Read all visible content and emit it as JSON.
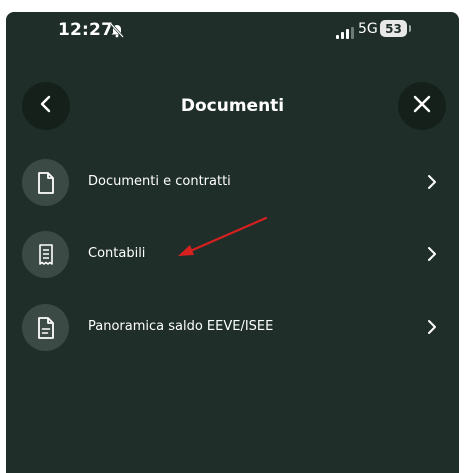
{
  "status_bar": {
    "time": "12:27",
    "network": "5G",
    "battery": "53",
    "icons": [
      "bell-slash-icon",
      "signal-icon",
      "battery-icon"
    ]
  },
  "header": {
    "title": "Documenti",
    "back_icon": "chevron-left-icon",
    "close_icon": "close-icon"
  },
  "menu": {
    "items": [
      {
        "label": "Documenti e contratti",
        "icon": "document-icon"
      },
      {
        "label": "Contabili",
        "icon": "receipt-icon"
      },
      {
        "label": "Panoramica saldo EEVE/ISEE",
        "icon": "document-lines-icon"
      }
    ]
  },
  "colors": {
    "background": "#1f2e29",
    "icon_circle": "#3c4a45",
    "annotation_arrow": "#d62020"
  }
}
